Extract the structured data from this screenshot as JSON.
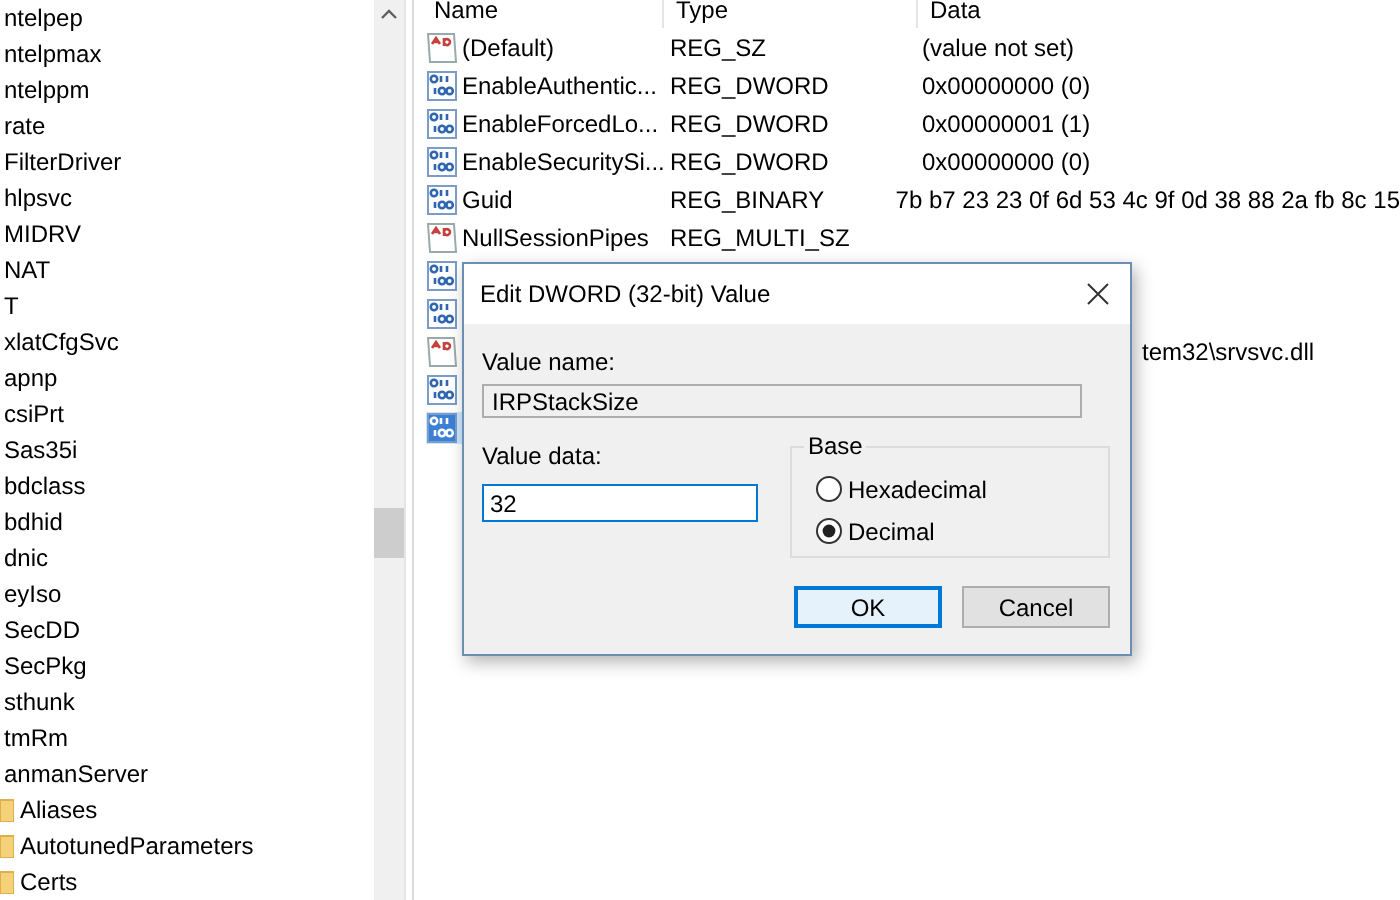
{
  "tree": {
    "items": [
      {
        "label": "ntelpep"
      },
      {
        "label": "ntelpmax"
      },
      {
        "label": "ntelppm"
      },
      {
        "label": "rate"
      },
      {
        "label": "FilterDriver"
      },
      {
        "label": "hlpsvc"
      },
      {
        "label": "MIDRV"
      },
      {
        "label": "NAT"
      },
      {
        "label": "T"
      },
      {
        "label": "xlatCfgSvc"
      },
      {
        "label": "apnp"
      },
      {
        "label": "csiPrt"
      },
      {
        "label": "Sas35i"
      },
      {
        "label": "bdclass"
      },
      {
        "label": "bdhid"
      },
      {
        "label": "dnic"
      },
      {
        "label": "eyIso"
      },
      {
        "label": "SecDD"
      },
      {
        "label": "SecPkg"
      },
      {
        "label": "sthunk"
      },
      {
        "label": "tmRm"
      },
      {
        "label": "anmanServer",
        "children": [
          {
            "label": "Aliases"
          },
          {
            "label": "AutotunedParameters"
          },
          {
            "label": "Certs"
          }
        ]
      }
    ]
  },
  "values": {
    "columns": [
      "Name",
      "Type",
      "Data"
    ],
    "rows": [
      {
        "kind": "string",
        "name": "(Default)",
        "type": "REG_SZ",
        "data": "(value not set)",
        "selected": false
      },
      {
        "kind": "dword",
        "name": "EnableAuthentic...",
        "type": "REG_DWORD",
        "data": "0x00000000 (0)",
        "selected": false
      },
      {
        "kind": "dword",
        "name": "EnableForcedLo...",
        "type": "REG_DWORD",
        "data": "0x00000001 (1)",
        "selected": false
      },
      {
        "kind": "dword",
        "name": "EnableSecuritySi...",
        "type": "REG_DWORD",
        "data": "0x00000000 (0)",
        "selected": false
      },
      {
        "kind": "binary",
        "name": "Guid",
        "type": "REG_BINARY",
        "data": "7b b7 23 23 0f 6d 53 4c 9f 0d 38 88 2a fb 8c 15",
        "selected": false
      },
      {
        "kind": "string",
        "name": "NullSessionPipes",
        "type": "REG_MULTI_SZ",
        "selected": false
      },
      {
        "kind": "dword",
        "selected": false
      },
      {
        "kind": "dword",
        "selected": false
      },
      {
        "kind": "string",
        "data": "tem32\\srvsvc.dll",
        "selected": false
      },
      {
        "kind": "dword",
        "selected": false
      },
      {
        "kind": "dword",
        "selected": true
      }
    ]
  },
  "dialog": {
    "title": "Edit DWORD (32-bit) Value",
    "value_name_label": "Value name:",
    "value_name": "IRPStackSize",
    "value_data_label": "Value data:",
    "value_data": "32",
    "base_label": "Base",
    "radios": [
      {
        "label": "Hexadecimal",
        "selected": false
      },
      {
        "label": "Decimal",
        "selected": true
      }
    ],
    "buttons": [
      {
        "label": "OK",
        "default": true
      },
      {
        "label": "Cancel",
        "default": false
      }
    ]
  }
}
